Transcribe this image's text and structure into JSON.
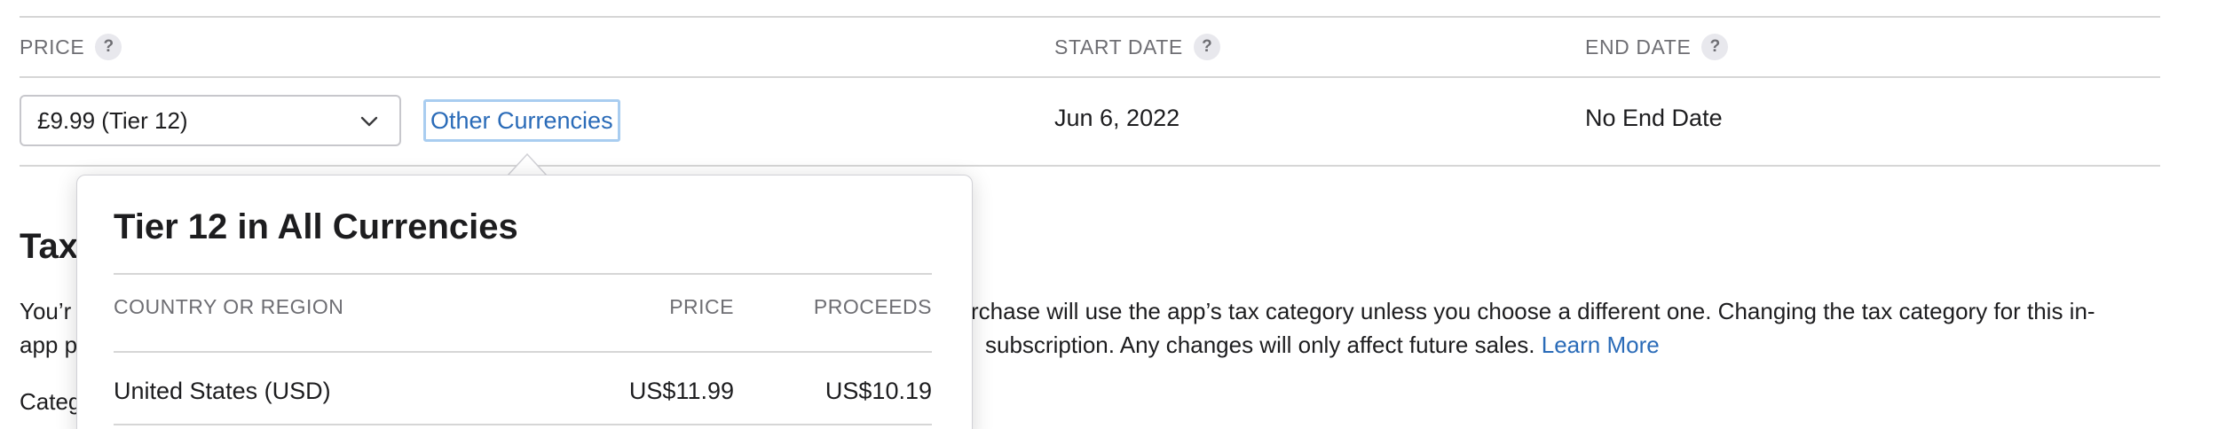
{
  "table": {
    "headers": {
      "price": "PRICE",
      "start_date": "START DATE",
      "end_date": "END DATE",
      "help_glyph": "?"
    },
    "row": {
      "price_select_value": "£9.99 (Tier 12)",
      "other_currencies_link": "Other Currencies",
      "start_date": "Jun 6, 2022",
      "end_date": "No End Date"
    }
  },
  "tax": {
    "title_visible": "Tax",
    "line1_left": "You’r",
    "line1_right": "rchase will use the app’s tax category unless you choose a different one. Changing the tax category for this in-",
    "line2_left": "app p",
    "line2_right": "subscription. Any changes will only affect future sales.",
    "learn_more": "Learn More",
    "category_label_visible": "Categ"
  },
  "popover": {
    "title": "Tier 12 in All Currencies",
    "columns": {
      "country": "COUNTRY OR REGION",
      "price": "PRICE",
      "proceeds": "PROCEEDS"
    },
    "rows": [
      {
        "country": "United States (USD)",
        "price": "US$11.99",
        "proceeds": "US$10.19"
      }
    ]
  },
  "colors": {
    "link": "#2a6bb8",
    "focus_ring": "#a9cdf0",
    "muted_text": "#6e6e73",
    "divider": "#d6d6d6"
  },
  "icons": {
    "select_chevron": "chevron-down-icon",
    "help": "help-icon"
  }
}
